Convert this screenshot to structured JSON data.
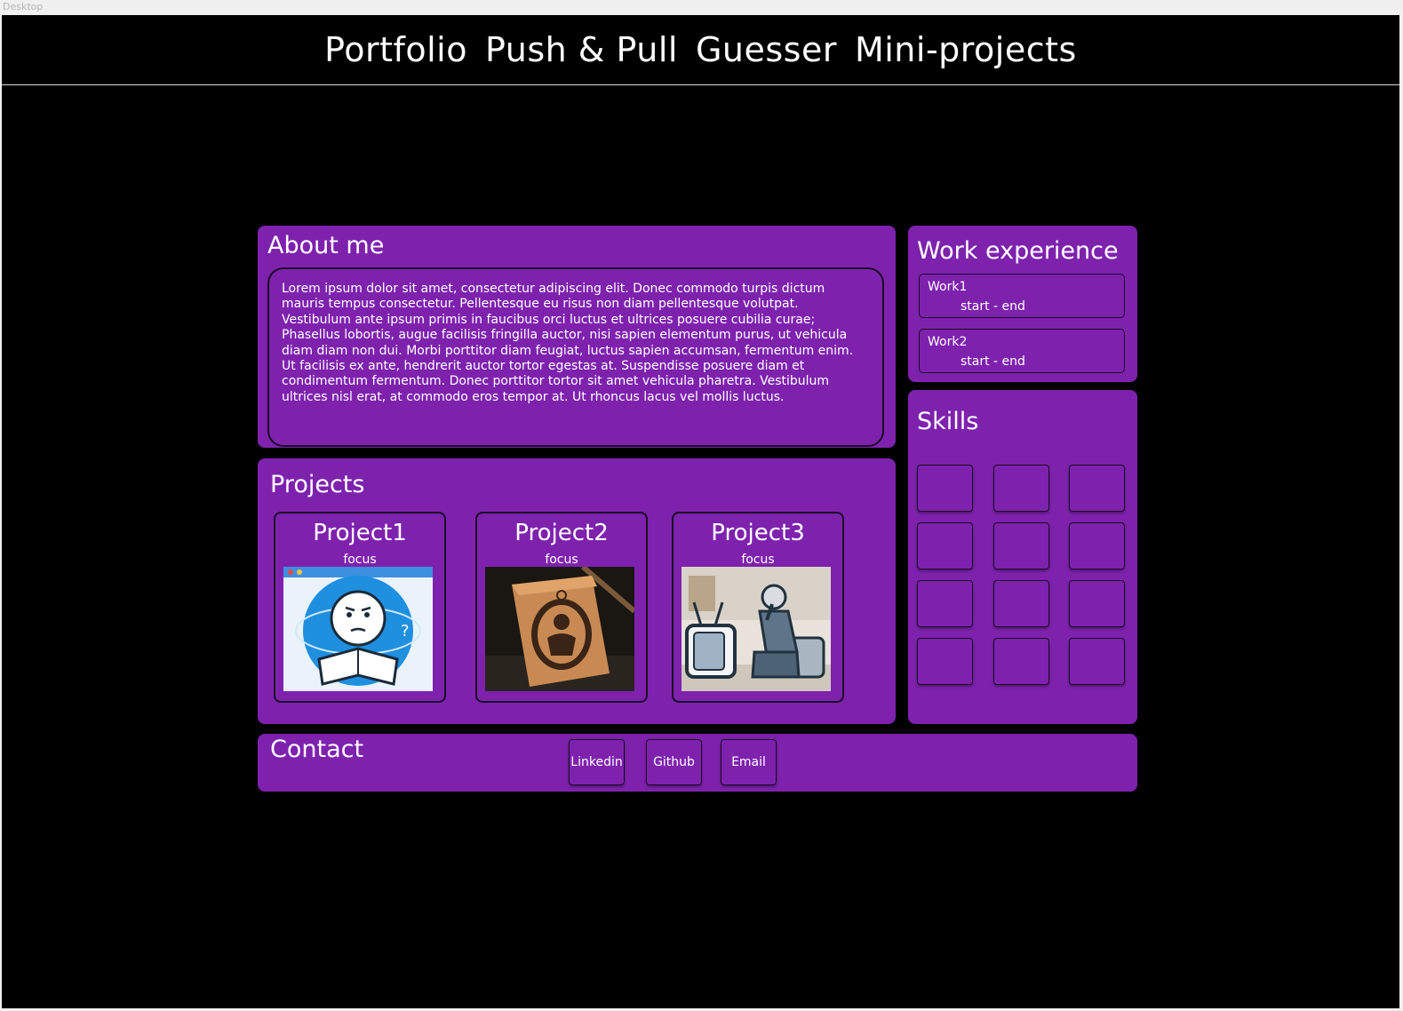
{
  "frame_label": "Desktop",
  "nav": {
    "items": [
      "Portfolio",
      "Push & Pull",
      "Guesser",
      "Mini-projects"
    ]
  },
  "about": {
    "title": "About me",
    "text": "Lorem ipsum dolor sit amet, consectetur adipiscing elit. Donec commodo turpis dictum mauris tempus consectetur. Pellentesque eu risus non diam pellentesque volutpat. Vestibulum ante ipsum primis in faucibus orci luctus et ultrices posuere cubilia curae; Phasellus lobortis, augue facilisis fringilla auctor, nisi sapien elementum purus, ut vehicula diam diam non dui. Morbi porttitor diam feugiat, luctus sapien accumsan, fermentum enim. Ut facilisis ex ante, hendrerit auctor tortor egestas at. Suspendisse posuere diam et condimentum fermentum. Donec porttitor tortor sit amet vehicula pharetra. Vestibulum ultrices nisl erat, at commodo eros tempor at. Ut rhoncus lacus vel mollis luctus."
  },
  "work": {
    "title": "Work experience",
    "items": [
      {
        "name": "Work1",
        "dates": "start - end"
      },
      {
        "name": "Work2",
        "dates": "start - end"
      }
    ]
  },
  "skills": {
    "title": "Skills",
    "slots": 12
  },
  "projects": {
    "title": "Projects",
    "items": [
      {
        "name": "Project1",
        "focus": "focus",
        "image": "thinking-reader-icon"
      },
      {
        "name": "Project2",
        "focus": "focus",
        "image": "box-emblem-icon"
      },
      {
        "name": "Project3",
        "focus": "focus",
        "image": "man-with-tv-icon"
      }
    ]
  },
  "contact": {
    "title": "Contact",
    "buttons": [
      "Linkedin",
      "Github",
      "Email"
    ]
  },
  "colors": {
    "background": "#000000",
    "panel": "#7e22ae",
    "text": "#ffffff",
    "border": "#1a0a24"
  }
}
